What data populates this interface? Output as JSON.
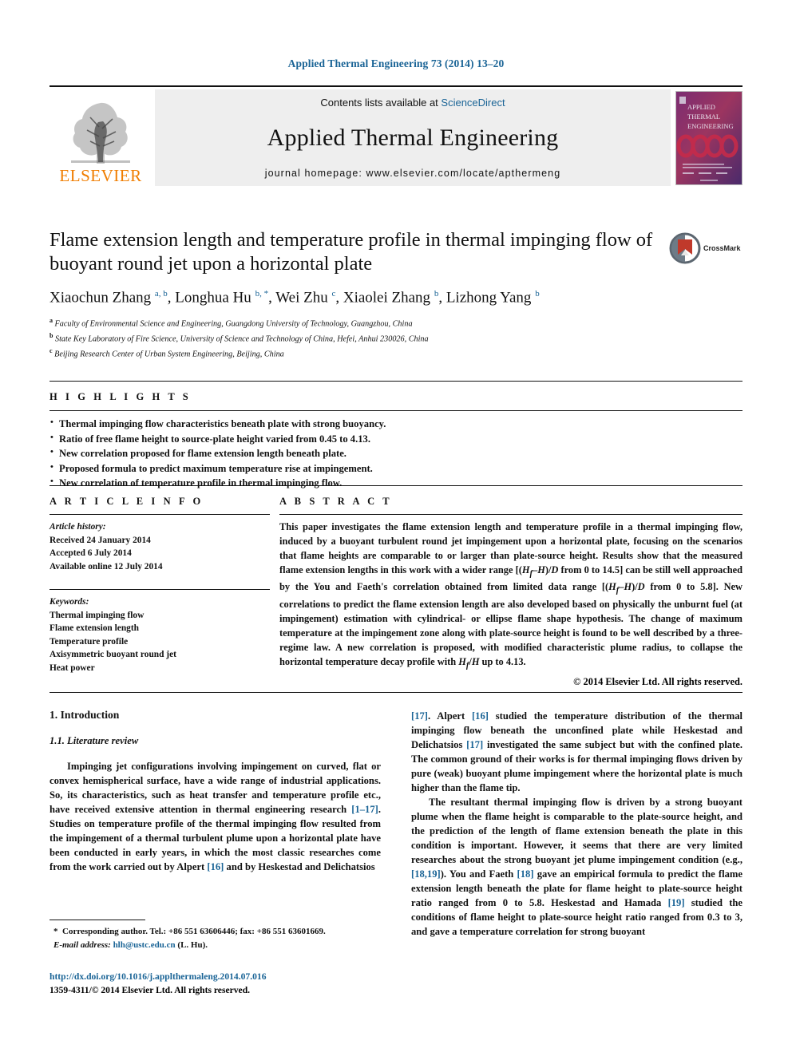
{
  "running_head": "Applied Thermal Engineering 73 (2014) 13–20",
  "masthead": {
    "publisher_name": "ELSEVIER",
    "contents_prefix": "Contents lists available at ",
    "contents_link": "ScienceDirect",
    "journal_name": "Applied Thermal Engineering",
    "homepage": "journal homepage: www.elsevier.com/locate/apthermeng",
    "cover": {
      "line1": "APPLIED",
      "line2": "THERMAL",
      "line3": "ENGINEERING"
    }
  },
  "article": {
    "title": "Flame extension length and temperature profile in thermal impinging flow of buoyant round jet upon a horizontal plate",
    "crossmark_label": "CrossMark",
    "authors_html": "Xiaochun Zhang <sup>a, b</sup>, Longhua Hu <sup>b, *</sup>, Wei Zhu <sup>c</sup>, Xiaolei Zhang <sup>b</sup>, Lizhong Yang <sup>b</sup>",
    "affiliations": [
      {
        "marker": "a",
        "text": "Faculty of Environmental Science and Engineering, Guangdong University of Technology, Guangzhou, China"
      },
      {
        "marker": "b",
        "text": "State Key Laboratory of Fire Science, University of Science and Technology of China, Hefei, Anhui 230026, China"
      },
      {
        "marker": "c",
        "text": "Beijing Research Center of Urban System Engineering, Beijing, China"
      }
    ]
  },
  "highlights": {
    "heading": "H I G H L I G H T S",
    "items": [
      "Thermal impinging flow characteristics beneath plate with strong buoyancy.",
      "Ratio of free flame height to source-plate height varied from 0.45 to 4.13.",
      "New correlation proposed for flame extension length beneath plate.",
      "Proposed formula to predict maximum temperature rise at impingement.",
      "New correlation of temperature profile in thermal impinging flow."
    ]
  },
  "article_info": {
    "heading": "A R T I C L E  I N F O",
    "history_label": "Article history:",
    "history": [
      "Received 24 January 2014",
      "Accepted 6 July 2014",
      "Available online 12 July 2014"
    ],
    "keywords_label": "Keywords:",
    "keywords": [
      "Thermal impinging flow",
      "Flame extension length",
      "Temperature profile",
      "Axisymmetric buoyant round jet",
      "Heat power"
    ]
  },
  "abstract": {
    "heading": "A B S T R A C T",
    "text_html": "This paper investigates the flame extension length and temperature profile in a thermal impinging flow, induced by a buoyant turbulent round jet impingement upon a horizontal plate, focusing on the scenarios that flame heights are comparable to or larger than plate-source height. Results show that the measured flame extension lengths in this work with a wider range [(<i class=\"v\">H<sub>f</sub></i>–<i class=\"v\">H</i>)/<i class=\"v\">D</i> from 0 to 14.5] can be still well approached by the You and Faeth's correlation obtained from limited data range [(<i class=\"v\">H<sub>f</sub></i>–<i class=\"v\">H</i>)/<i class=\"v\">D</i> from 0 to 5.8]. New correlations to predict the flame extension length are also developed based on physically the unburnt fuel (at impingement) estimation with cylindrical- or ellipse flame shape hypothesis. The change of maximum temperature at the impingement zone along with plate-source height is found to be well described by a three-regime law. A new correlation is proposed, with modified characteristic plume radius, to collapse the horizontal temperature decay profile with <i class=\"v\">H<sub>f</sub></i>/<i class=\"v\">H</i> up to 4.13.",
    "copyright": "© 2014 Elsevier Ltd. All rights reserved."
  },
  "body": {
    "section_number_title": "1. Introduction",
    "subsection_title": "1.1. Literature review",
    "left_paragraph_html": "Impinging jet configurations involving impingement on curved, flat or convex hemispherical surface, have a wide range of industrial applications. So, its characteristics, such as heat transfer and temperature profile etc., have received extensive attention in thermal engineering research <span class=\"ref\">[1–17]</span>. Studies on temperature profile of the thermal impinging flow resulted from the impingement of a thermal turbulent plume upon a horizontal plate have been conducted in early years, in which the most classic researches come from the work carried out by Alpert <span class=\"ref\">[16]</span> and by Heskestad and Delichatsios",
    "right_paragraph_1_html": "<span class=\"ref\">[17]</span>. Alpert <span class=\"ref\">[16]</span> studied the temperature distribution of the thermal impinging flow beneath the unconfined plate while Heskestad and Delichatsios <span class=\"ref\">[17]</span> investigated the same subject but with the confined plate. The common ground of their works is for thermal impinging flows driven by pure (weak) buoyant plume impingement where the horizontal plate is much higher than the flame tip.",
    "right_paragraph_2_html": "The resultant thermal impinging flow is driven by a strong buoyant plume when the flame height is comparable to the plate-source height, and the prediction of the length of flame extension beneath the plate in this condition is important. However, it seems that there are very limited researches about the strong buoyant jet plume impingement condition (e.g., <span class=\"ref\">[18,19]</span>). You and Faeth <span class=\"ref\">[18]</span> gave an empirical formula to predict the flame extension length beneath the plate for flame height to plate-source height ratio ranged from 0 to 5.8. Heskestad and Hamada <span class=\"ref\">[19]</span> studied the conditions of flame height to plate-source height ratio ranged from 0.3 to 3, and gave a temperature correlation for strong buoyant"
  },
  "footnote": {
    "corresponding_html": "<b>*</b>&nbsp; Corresponding author. Tel.: +86 551 63606446; fax: +86 551 63601669.",
    "email_label": "E-mail address:",
    "email": "hlh@ustc.edu.cn",
    "email_suffix": "(L. Hu)."
  },
  "footer": {
    "doi": "http://dx.doi.org/10.1016/j.applthermaleng.2014.07.016",
    "issn_line": "1359-4311/© 2014 Elsevier Ltd. All rights reserved."
  },
  "colors": {
    "link": "#1a6496",
    "elsevier_orange": "#f07d00",
    "rule": "#111111"
  }
}
